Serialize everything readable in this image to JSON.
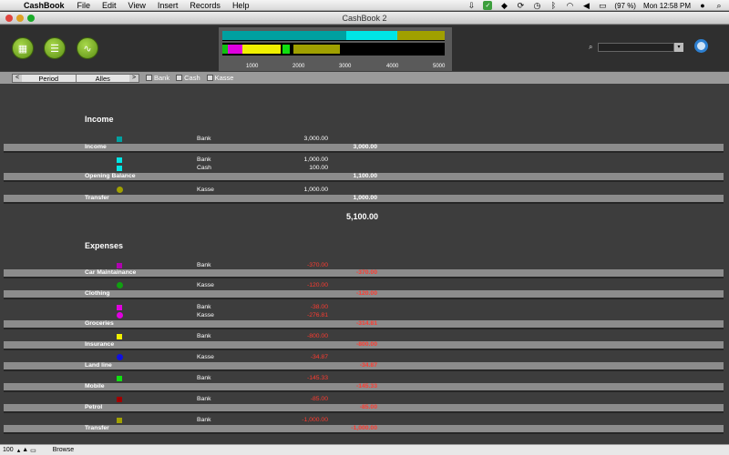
{
  "menubar": {
    "app_name": "CashBook",
    "items": [
      "File",
      "Edit",
      "View",
      "Insert",
      "Records",
      "Help"
    ],
    "battery": "(97 %)",
    "clock": "Mon 12:58 PM"
  },
  "window": {
    "title": "CashBook 2"
  },
  "toolbar": {
    "buttons": [
      "table-view",
      "report-view",
      "graph-view"
    ],
    "chart": {
      "ticks": [
        "1000",
        "2000",
        "3000",
        "4000",
        "5000"
      ],
      "colors": {
        "bank": "#00a0a0",
        "cash": "#00e5e5",
        "kasse": "#a0a000",
        "clothing": "#10c010",
        "groceries": "#e000e0",
        "insurance": "#f0f000"
      }
    },
    "search_placeholder": ""
  },
  "filter": {
    "period_label": "Period",
    "period_value": "Alles",
    "checkboxes": [
      "Bank",
      "Cash",
      "Kasse"
    ]
  },
  "income": {
    "title": "Income",
    "groups": [
      {
        "rows": [
          {
            "account": "Bank",
            "amount": "3,000.00"
          }
        ],
        "label": "Income",
        "total": "3,000.00"
      },
      {
        "rows": [
          {
            "account": "Bank",
            "amount": "1,000.00"
          },
          {
            "account": "Cash",
            "amount": "100.00"
          }
        ],
        "label": "Opening Balance",
        "total": "1,100.00"
      },
      {
        "rows": [
          {
            "account": "Kasse",
            "amount": "1,000.00"
          }
        ],
        "label": "Transfer",
        "total": "1,000.00"
      }
    ],
    "grand_total": "5,100.00"
  },
  "expenses": {
    "title": "Expenses",
    "groups": [
      {
        "rows": [
          {
            "account": "Bank",
            "amount": "-370.00"
          }
        ],
        "label": "Car Maintainance",
        "total": "-370.00"
      },
      {
        "rows": [
          {
            "account": "Kasse",
            "amount": "-120.00"
          }
        ],
        "label": "Clothing",
        "total": "-120.00"
      },
      {
        "rows": [
          {
            "account": "Bank",
            "amount": "-38.00"
          },
          {
            "account": "Kasse",
            "amount": "-276.81"
          }
        ],
        "label": "Groceries",
        "total": "-314.81"
      },
      {
        "rows": [
          {
            "account": "Bank",
            "amount": "-800.00"
          }
        ],
        "label": "Insurance",
        "total": "-800.00"
      },
      {
        "rows": [
          {
            "account": "Kasse",
            "amount": "-34.87"
          }
        ],
        "label": "Land line",
        "total": "-34.87"
      },
      {
        "rows": [
          {
            "account": "Bank",
            "amount": "-145.33"
          }
        ],
        "label": "Mobile",
        "total": "-145.33"
      },
      {
        "rows": [
          {
            "account": "Bank",
            "amount": "-85.00"
          }
        ],
        "label": "Petrol",
        "total": "-85.00"
      },
      {
        "rows": [
          {
            "account": "Bank",
            "amount": "-1,000.00"
          }
        ],
        "label": "Transfer",
        "total": "-1,000.00"
      }
    ]
  },
  "statusbar": {
    "zoom": "100",
    "mode": "Browse"
  }
}
